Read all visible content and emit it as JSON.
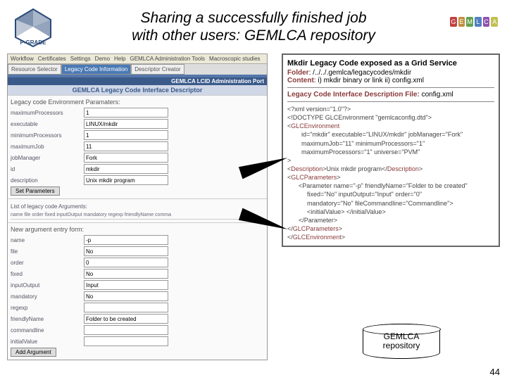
{
  "header": {
    "title_line1": "Sharing a successfully finished job",
    "title_line2": "with other users: GEMLCA repository",
    "puzzle_letters": [
      "G",
      "E",
      "M",
      "L",
      "C",
      "A"
    ],
    "puzzle_colors": [
      "#c04040",
      "#c09040",
      "#60a050",
      "#5080c0",
      "#9050b0",
      "#c0c050"
    ]
  },
  "left_panel": {
    "toolbar": [
      "Workflow",
      "Certificates",
      "Settings",
      "Demo",
      "Help",
      "GEMLCA Administration Tools",
      "Macroscopic studies"
    ],
    "tabs": [
      "Resource Selector",
      "Legacy Code Information",
      "Descriptor Creator"
    ],
    "portal_title": "GEMLCA LCID Administration Port",
    "descriptor_title": "GEMLCA Legacy Code Interface Descriptor",
    "env_heading": "Legacy code Environment Paramaters:",
    "env_fields": {
      "maximumProcessors": {
        "label": "maximumProcessors",
        "value": "1"
      },
      "executable": {
        "label": "executable",
        "value": "LINUX/mkdir"
      },
      "minimumProcessors": {
        "label": "minimumProcessors",
        "value": "1"
      },
      "maximumJob": {
        "label": "maximumJob",
        "value": "11"
      },
      "jobManager": {
        "label": "jobManager",
        "value": "Fork"
      },
      "id": {
        "label": "id",
        "value": "mkdir"
      },
      "description": {
        "label": "description",
        "value": "Unix mkdir program"
      }
    },
    "set_params_btn": "Set Parameters",
    "list_heading": "List of legacy code Arguments:",
    "list_cols": "name file order fixed inputOutput mandatory regexp friendlyName comma",
    "new_arg_heading": "New argument entry form:",
    "arg_fields": {
      "name": {
        "label": "name",
        "value": "-p"
      },
      "file": {
        "label": "file",
        "value": "No"
      },
      "order": {
        "label": "order",
        "value": "0"
      },
      "fixed": {
        "label": "fixed",
        "value": "No"
      },
      "inputOutput": {
        "label": "inputOutput",
        "value": "Input"
      },
      "mandatory": {
        "label": "mandatory",
        "value": "No"
      },
      "regexp": {
        "label": "regexp",
        "value": ""
      },
      "friendlyName": {
        "label": "friendlyName",
        "value": "Folder to be created"
      },
      "commandline": {
        "label": "commandline",
        "value": ""
      },
      "initialValue": {
        "label": "initialValue",
        "value": ""
      }
    },
    "add_arg_btn": "Add Argument"
  },
  "right_panel": {
    "title": "Mkdir Legacy Code exposed as a Grid Service",
    "folder_k": "Folder",
    "folder_v": ": /../../.gemlca/legacycodes/mkdir",
    "content_k": "Content",
    "content_v": ": i) mkdir binary or link ii) config.xml",
    "sub_title": "Legacy Code Interface Description File:",
    "sub_file": " config.xml",
    "xml": {
      "l1": "<?xml version=\"1.0\"?>",
      "l2": "<!DOCTYPE GLCEnvironment \"gemlcaconfig.dtd\">",
      "l3o": "<",
      "l3t": "GLCEnvironment",
      "l4": "id=\"mkdir\" executable=\"LINUX/mkdir\" jobManager=\"Fork\"",
      "l5": "maximumJob=\"11\" minimumProcessors=\"1\"",
      "l6": "maximumProcessors=\"1\" universe=\"PVM\"",
      "l7": ">",
      "l8a": "<",
      "l8t": "Description",
      "l8b": ">Unix mkdir program</",
      "l8c": ">",
      "l9a": "<",
      "l9t": "GLCParameters",
      "l9b": ">",
      "l10": "<Parameter name=\"-p\" friendlyName=\"Folder to be created\"",
      "l11": "fixed=\"No\" inputOutput=\"Input\" order=\"0\"",
      "l12": "mandatory=\"No\" fileCommandline=\"Commandline\">",
      "l13": "<initialValue> </initialValue>",
      "l14": "</Parameter>",
      "l15a": "</",
      "l15t": "GLCParameters",
      "l15b": ">",
      "l16a": "</",
      "l16t": "GLCEnvironment",
      "l16b": ">"
    }
  },
  "repo": {
    "line1": "GEMLCA",
    "line2": "repository"
  },
  "page_number": "44"
}
